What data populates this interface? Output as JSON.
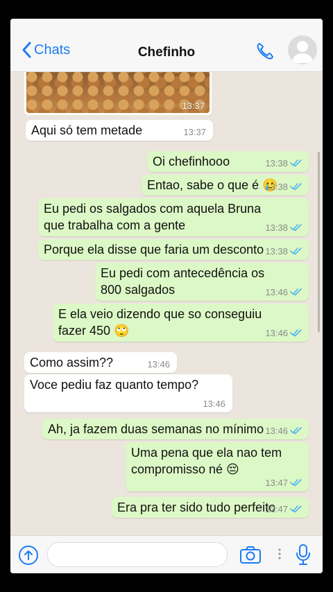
{
  "header": {
    "back_label": "Chats",
    "title": "Chefinho"
  },
  "photo": {
    "time": "13:37"
  },
  "messages": [
    {
      "dir": "in",
      "lines": [
        "Aqui só tem metade"
      ],
      "time": "13:37"
    },
    {
      "dir": "out",
      "lines": [
        "Oi chefinhooo"
      ],
      "time": "13:38"
    },
    {
      "dir": "out",
      "lines": [
        "Entao, sabe o que é 🥲"
      ],
      "time": "13:38"
    },
    {
      "dir": "out",
      "lines": [
        "Eu pedi os salgados com aquela Bruna",
        "que trabalha com a gente"
      ],
      "time": "13:38"
    },
    {
      "dir": "out",
      "lines": [
        "Porque ela disse que faria um desconto"
      ],
      "time": "13:38"
    },
    {
      "dir": "out",
      "lines": [
        "Eu pedi com antecedência os",
        "800 salgados"
      ],
      "time": "13:46"
    },
    {
      "dir": "out",
      "lines": [
        "E ela veio dizendo que so conseguiu",
        "fazer 450 🙄"
      ],
      "time": "13:46"
    },
    {
      "dir": "in",
      "lines": [
        "Como assim??"
      ],
      "time": "13:46"
    },
    {
      "dir": "in",
      "lines": [
        "Voce pediu faz quanto tempo?"
      ],
      "time": "13:46"
    },
    {
      "dir": "out",
      "lines": [
        "Ah, ja fazem duas semanas no mínimo"
      ],
      "time": "13:46"
    },
    {
      "dir": "out",
      "lines": [
        "Uma pena que ela nao tem",
        "compromisso né 😔"
      ],
      "time": "13:47"
    },
    {
      "dir": "out",
      "lines": [
        "Era pra ter sido tudo perfeito"
      ],
      "time": "13:47"
    }
  ],
  "input": {
    "placeholder": ""
  },
  "colors": {
    "accent": "#1a7cf5",
    "outgoing": "#dcf8c6",
    "incoming": "#ffffff",
    "wallpaper": "#ece5dd",
    "read_tick": "#4fb6ec"
  },
  "icons": {
    "back": "chevron-left-icon",
    "call": "phone-icon",
    "attach": "plus-circle-icon",
    "camera": "camera-icon",
    "mic": "microphone-icon"
  }
}
